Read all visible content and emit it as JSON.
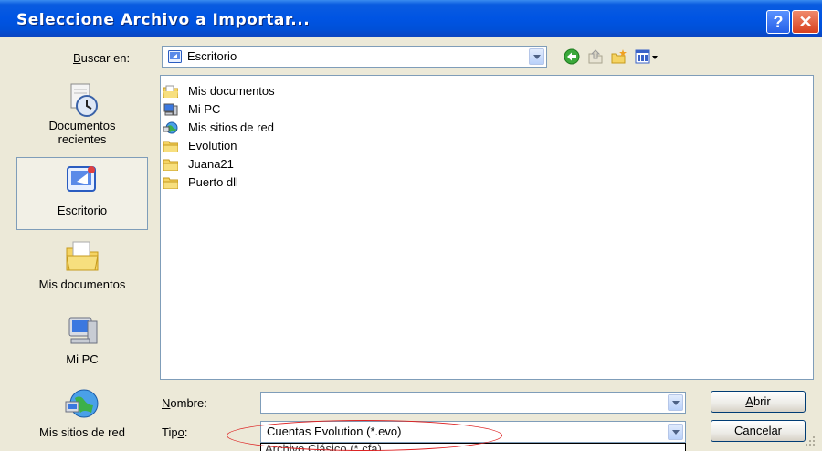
{
  "window": {
    "title": "Seleccione Archivo a Importar...",
    "help_symbol": "?",
    "close_symbol": "✕"
  },
  "toolbar": {
    "lookin_label_accel": "B",
    "lookin_label_rest": "uscar en:",
    "lookin_value": "Escritorio",
    "back_icon": "back-arrow-icon",
    "up_icon": "up-folder-icon",
    "new_folder_icon": "new-folder-icon",
    "views_icon": "views-menu-icon"
  },
  "places": [
    {
      "label": "Documentos\nrecientes",
      "icon": "recent-documents-icon"
    },
    {
      "label": "Escritorio",
      "icon": "desktop-icon",
      "selected": true
    },
    {
      "label": "Mis documentos",
      "icon": "my-documents-icon"
    },
    {
      "label": "Mi PC",
      "icon": "my-computer-icon"
    },
    {
      "label": "Mis sitios de red",
      "icon": "network-places-icon"
    }
  ],
  "files": [
    {
      "name": "Mis documentos",
      "icon": "my-documents-icon"
    },
    {
      "name": "Mi PC",
      "icon": "my-computer-icon"
    },
    {
      "name": "Mis sitios de red",
      "icon": "network-places-icon"
    },
    {
      "name": "Evolution",
      "icon": "folder-icon"
    },
    {
      "name": "Juana21",
      "icon": "folder-icon"
    },
    {
      "name": "Puerto dll",
      "icon": "folder-icon"
    }
  ],
  "form": {
    "filename_label_accel": "N",
    "filename_label_rest": "ombre:",
    "filename_value": "",
    "type_label_pre": "Tip",
    "type_label_accel": "o",
    "type_label_rest": ":",
    "type_value": "Cuentas Evolution (*.evo)",
    "type_option_partial": "Archivo Clásico (*.cfa)"
  },
  "buttons": {
    "open_accel": "A",
    "open_rest": "brir",
    "cancel": "Cancelar"
  },
  "colors": {
    "titlebar": "#0054e3",
    "dialog_bg": "#ece9d8",
    "highlight_ellipse": "#dd2222"
  }
}
